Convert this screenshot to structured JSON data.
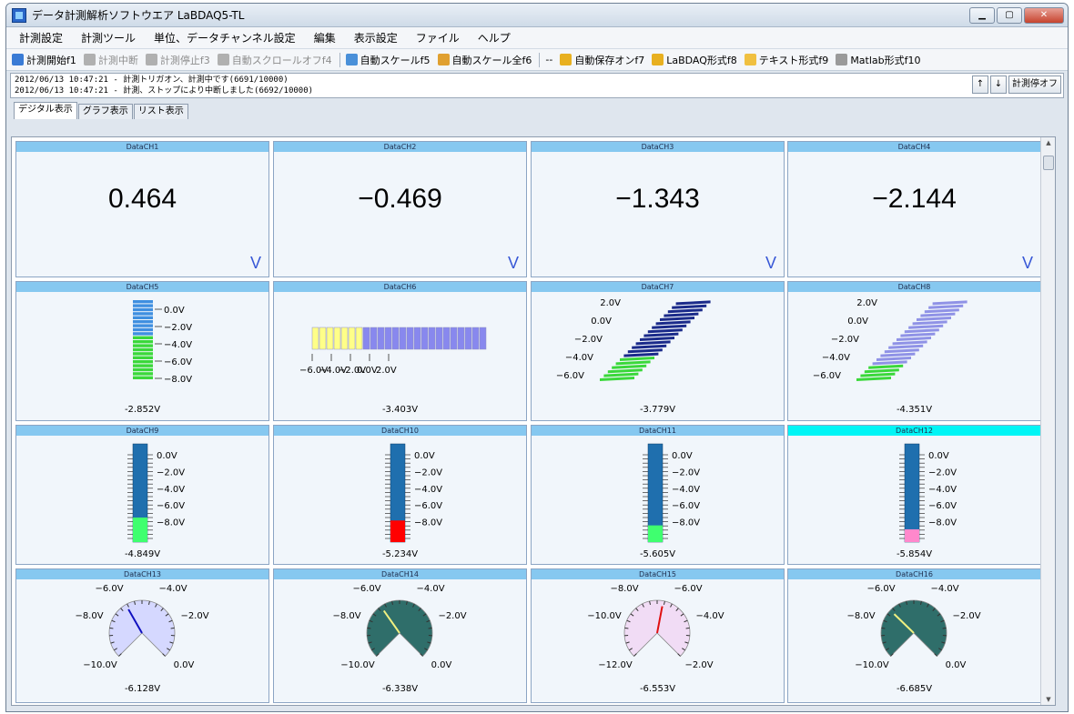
{
  "window": {
    "title": "データ計測解析ソフトウエア LaBDAQ5-TL"
  },
  "menu": [
    "計測設定",
    "計測ツール",
    "単位、データチャンネル設定",
    "編集",
    "表示設定",
    "ファイル",
    "ヘルプ"
  ],
  "toolbar": [
    {
      "label": "計測開始f1",
      "enabled": true,
      "icon": "play-icon",
      "color": "#3a7bd5"
    },
    {
      "label": "計測中断",
      "enabled": false,
      "icon": "pause-icon",
      "color": "#b0b0b0"
    },
    {
      "label": "計測停止f3",
      "enabled": false,
      "icon": "stop-icon",
      "color": "#b0b0b0"
    },
    {
      "label": "自動スクロールオフf4",
      "enabled": false,
      "icon": "scroll-icon",
      "color": "#b0b0b0"
    },
    {
      "label": "自動スケールf5",
      "enabled": true,
      "icon": "scale-icon",
      "color": "#4a90d9"
    },
    {
      "label": "自動スケール全f6",
      "enabled": true,
      "icon": "scale-all-icon",
      "color": "#e0a030"
    },
    {
      "label": "--",
      "enabled": true,
      "icon": "",
      "color": ""
    },
    {
      "label": "自動保存オンf7",
      "enabled": true,
      "icon": "save-icon",
      "color": "#e8b020"
    },
    {
      "label": "LaBDAQ形式f8",
      "enabled": true,
      "icon": "labdaq-file-icon",
      "color": "#e8b020"
    },
    {
      "label": "テキスト形式f9",
      "enabled": true,
      "icon": "text-folder-icon",
      "color": "#f0c040"
    },
    {
      "label": "Matlab形式f10",
      "enabled": true,
      "icon": "matlab-icon",
      "color": "#9a9a9a"
    }
  ],
  "log": {
    "lines": [
      "2012/06/13 10:47:21 - 計測トリガオン、計測中です(6691/10000)",
      "2012/06/13 10:47:21 - 計測、ストップにより中断しました(6692/10000)"
    ],
    "up_label": "↑",
    "down_label": "↓",
    "stop_label": "計測停オフ"
  },
  "tabs": [
    {
      "label": "デジタル表示",
      "active": true
    },
    {
      "label": "グラフ表示",
      "active": false
    },
    {
      "label": "リスト表示",
      "active": false
    }
  ],
  "digital": [
    {
      "name": "DataCH1",
      "value": "0.464",
      "unit": "V"
    },
    {
      "name": "DataCH2",
      "value": "−0.469",
      "unit": "V"
    },
    {
      "name": "DataCH3",
      "value": "−1.343",
      "unit": "V"
    },
    {
      "name": "DataCH4",
      "value": "−2.144",
      "unit": "V"
    }
  ],
  "row2": [
    {
      "name": "DataCH5",
      "type": "vbar",
      "readout": "-2.852V",
      "ticks": [
        "0.0V",
        "−2.0V",
        "−4.0V",
        "−6.0V",
        "−8.0V"
      ],
      "top_color": "#3f8fe0",
      "fill_color": "#3ad83a",
      "fill_fraction": 0.56
    },
    {
      "name": "DataCH6",
      "type": "hbar",
      "readout": "-3.403V",
      "ticks": [
        "−6.0V",
        "−4.0V",
        "−2.0V",
        "0.0V",
        "2.0V"
      ],
      "fill_color": "#ffff88",
      "rest_color": "#8888ee",
      "fill_fraction": 0.28
    },
    {
      "name": "DataCH7",
      "type": "slant",
      "readout": "-3.779V",
      "ticks": [
        "2.0V",
        "0.0V",
        "−2.0V",
        "−4.0V",
        "−6.0V"
      ],
      "top_color": "#1a2a8a",
      "fill_color": "#3ad83a",
      "fill_fraction": 0.28
    },
    {
      "name": "DataCH8",
      "type": "slant",
      "readout": "-4.351V",
      "ticks": [
        "2.0V",
        "0.0V",
        "−2.0V",
        "−4.0V",
        "−6.0V"
      ],
      "top_color": "#8f92e6",
      "fill_color": "#3ad83a",
      "fill_fraction": 0.2
    }
  ],
  "row3": [
    {
      "name": "DataCH9",
      "readout": "-4.849V",
      "ticks": [
        "0.0V",
        "−2.0V",
        "−4.0V",
        "−6.0V",
        "−8.0V"
      ],
      "fill_color": "#3fff6f",
      "fill_fraction": 0.25,
      "highlight": false
    },
    {
      "name": "DataCH10",
      "readout": "-5.234V",
      "ticks": [
        "0.0V",
        "−2.0V",
        "−4.0V",
        "−6.0V",
        "−8.0V"
      ],
      "fill_color": "#ff0000",
      "fill_fraction": 0.22,
      "highlight": false
    },
    {
      "name": "DataCH11",
      "readout": "-5.605V",
      "ticks": [
        "0.0V",
        "−2.0V",
        "−4.0V",
        "−6.0V",
        "−8.0V"
      ],
      "fill_color": "#3fff6f",
      "fill_fraction": 0.17,
      "highlight": false
    },
    {
      "name": "DataCH12",
      "readout": "-5.854V",
      "ticks": [
        "0.0V",
        "−2.0V",
        "−4.0V",
        "−6.0V",
        "−8.0V"
      ],
      "fill_color": "#ff88cc",
      "fill_fraction": 0.13,
      "highlight": true
    }
  ],
  "row4": [
    {
      "name": "DataCH13",
      "readout": "-6.128V",
      "labels": [
        "−6.0V",
        "−4.0V",
        "−8.0V",
        "−2.0V",
        "−10.0V",
        "0.0V"
      ],
      "face_color": "#d5d8ff",
      "needle_color": "#1010c0",
      "needle_fraction": 0.39
    },
    {
      "name": "DataCH14",
      "readout": "-6.338V",
      "labels": [
        "−6.0V",
        "−4.0V",
        "−8.0V",
        "−2.0V",
        "−10.0V",
        "0.0V"
      ],
      "face_color": "#2f6e6a",
      "needle_color": "#f0f080",
      "needle_fraction": 0.37
    },
    {
      "name": "DataCH15",
      "readout": "-6.553V",
      "labels": [
        "−8.0V",
        "−6.0V",
        "−10.0V",
        "−4.0V",
        "−12.0V",
        "−2.0V"
      ],
      "face_color": "#f1dcf5",
      "needle_color": "#e01010",
      "needle_fraction": 0.54
    },
    {
      "name": "DataCH16",
      "readout": "-6.685V",
      "labels": [
        "−6.0V",
        "−4.0V",
        "−8.0V",
        "−2.0V",
        "−10.0V",
        "0.0V"
      ],
      "face_color": "#2f6e6a",
      "needle_color": "#f0f080",
      "needle_fraction": 0.33
    }
  ]
}
